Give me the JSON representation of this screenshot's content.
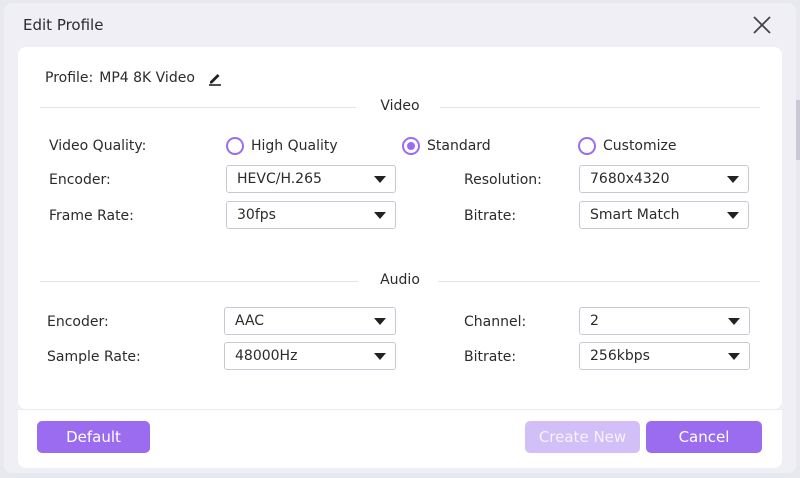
{
  "dialog": {
    "title": "Edit Profile"
  },
  "profile": {
    "label": "Profile:",
    "value": "MP4 8K Video"
  },
  "video": {
    "section_title": "Video",
    "quality_label": "Video Quality:",
    "quality_options": [
      {
        "label": "High Quality",
        "checked": false
      },
      {
        "label": "Standard",
        "checked": true
      },
      {
        "label": "Customize",
        "checked": false
      }
    ],
    "encoder_label": "Encoder:",
    "encoder_value": "HEVC/H.265",
    "resolution_label": "Resolution:",
    "resolution_value": "7680x4320",
    "frame_rate_label": "Frame Rate:",
    "frame_rate_value": "30fps",
    "bitrate_label": "Bitrate:",
    "bitrate_value": "Smart Match"
  },
  "audio": {
    "section_title": "Audio",
    "encoder_label": "Encoder:",
    "encoder_value": "AAC",
    "channel_label": "Channel:",
    "channel_value": "2",
    "sample_rate_label": "Sample Rate:",
    "sample_rate_value": "48000Hz",
    "bitrate_label": "Bitrate:",
    "bitrate_value": "256kbps"
  },
  "footer": {
    "default_label": "Default",
    "create_new_label": "Create New",
    "cancel_label": "Cancel"
  },
  "colors": {
    "accent": "#9b6cf0",
    "accent_disabled": "#d3bff7"
  },
  "icons": {
    "close": "close-icon",
    "edit": "pencil-icon",
    "dropdown": "chevron-down-icon"
  }
}
